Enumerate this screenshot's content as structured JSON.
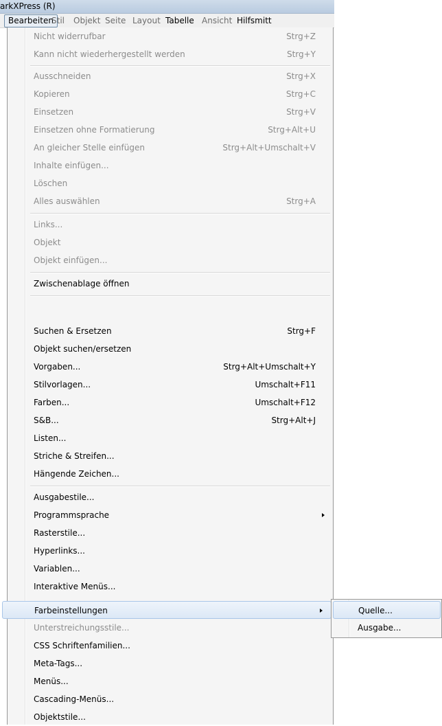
{
  "app": {
    "title": "arkXPress (R)"
  },
  "menubar": {
    "items": [
      {
        "label": "Bearbeiten",
        "state": "active"
      },
      {
        "label": "Stil",
        "state": "disabled"
      },
      {
        "label": "Objekt",
        "state": "disabled"
      },
      {
        "label": "Seite",
        "state": "disabled"
      },
      {
        "label": "Layout",
        "state": "disabled"
      },
      {
        "label": "Tabelle",
        "state": "enabled"
      },
      {
        "label": "Ansicht",
        "state": "disabled"
      },
      {
        "label": "Hilfsmitt",
        "state": "enabled"
      }
    ]
  },
  "menu": {
    "items": [
      {
        "label": "Nicht widerrufbar",
        "shortcut": "Strg+Z",
        "disabled": true
      },
      {
        "label": "Kann nicht wiederhergestellt werden",
        "shortcut": "Strg+Y",
        "disabled": true
      },
      {
        "label": "Ausschneiden",
        "shortcut": "Strg+X",
        "disabled": true
      },
      {
        "label": "Kopieren",
        "shortcut": "Strg+C",
        "disabled": true
      },
      {
        "label": "Einsetzen",
        "shortcut": "Strg+V",
        "disabled": true
      },
      {
        "label": "Einsetzen ohne Formatierung",
        "shortcut": "Strg+Alt+U",
        "disabled": true
      },
      {
        "label": "An gleicher Stelle einfügen",
        "shortcut": "Strg+Alt+Umschalt+V",
        "disabled": true
      },
      {
        "label": "Inhalte einfügen...",
        "shortcut": "",
        "disabled": true
      },
      {
        "label": "Löschen",
        "shortcut": "",
        "disabled": true
      },
      {
        "label": "Alles auswählen",
        "shortcut": "Strg+A",
        "disabled": true
      },
      {
        "label": "Links...",
        "shortcut": "",
        "disabled": true
      },
      {
        "label": "Objekt",
        "shortcut": "",
        "disabled": true
      },
      {
        "label": "Objekt einfügen...",
        "shortcut": "",
        "disabled": true
      },
      {
        "label": "Zwischenablage öffnen",
        "shortcut": "",
        "disabled": false
      },
      {
        "label": "Suchen & Ersetzen",
        "shortcut": "Strg+F",
        "disabled": false
      },
      {
        "label": "Objekt suchen/ersetzen",
        "shortcut": "",
        "disabled": false
      },
      {
        "label": "Vorgaben...",
        "shortcut": "Strg+Alt+Umschalt+Y",
        "disabled": false
      },
      {
        "label": "Stilvorlagen...",
        "shortcut": "Umschalt+F11",
        "disabled": false
      },
      {
        "label": "Farben...",
        "shortcut": "Umschalt+F12",
        "disabled": false
      },
      {
        "label": "S&B...",
        "shortcut": "Strg+Alt+J",
        "disabled": false
      },
      {
        "label": "Listen...",
        "shortcut": "",
        "disabled": false
      },
      {
        "label": "Striche & Streifen...",
        "shortcut": "",
        "disabled": false
      },
      {
        "label": "Hängende Zeichen...",
        "shortcut": "",
        "disabled": false
      },
      {
        "label": "Ausgabestile...",
        "shortcut": "",
        "disabled": false
      },
      {
        "label": "Programmsprache",
        "shortcut": "",
        "disabled": false,
        "submenu": true
      },
      {
        "label": "Rasterstile...",
        "shortcut": "",
        "disabled": false
      },
      {
        "label": "Hyperlinks...",
        "shortcut": "",
        "disabled": false
      },
      {
        "label": "Variablen...",
        "shortcut": "",
        "disabled": false
      },
      {
        "label": "Interaktive Menüs...",
        "shortcut": "",
        "disabled": false
      },
      {
        "label": "Farbeinstellungen",
        "shortcut": "",
        "disabled": false,
        "submenu": true,
        "highlighted": true
      },
      {
        "label": "Unterstreichungsstile...",
        "shortcut": "",
        "disabled": true
      },
      {
        "label": "CSS Schriftenfamilien...",
        "shortcut": "",
        "disabled": false
      },
      {
        "label": "Meta-Tags...",
        "shortcut": "",
        "disabled": false
      },
      {
        "label": "Menüs...",
        "shortcut": "",
        "disabled": false
      },
      {
        "label": "Cascading-Menüs...",
        "shortcut": "",
        "disabled": false
      },
      {
        "label": "Objektstile...",
        "shortcut": "",
        "disabled": false
      }
    ]
  },
  "submenu": {
    "items": [
      {
        "label": "Quelle...",
        "highlighted": true
      },
      {
        "label": "Ausgabe...",
        "highlighted": false
      }
    ]
  }
}
